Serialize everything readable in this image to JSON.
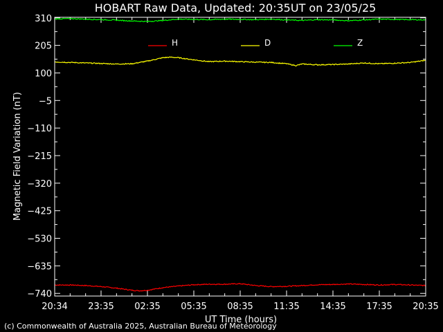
{
  "colors": {
    "background": "#000000",
    "axes": "#ffffff",
    "H": "#ff0000",
    "D": "#ffff00",
    "Z": "#00ff00"
  },
  "chart_data": {
    "type": "line",
    "title": "HOBART Raw Data, Updated: 20:35UT on 23/05/25",
    "xlabel": "UT Time (hours)",
    "ylabel": "Magnetic Field Variation (nT)",
    "footer": "(c) Commonwealth of Australia 2025, Australian Bureau of Meteorology",
    "xlim": [
      0,
      24
    ],
    "ylim": [
      -750,
      312
    ],
    "x_tick_labels": [
      "20:34",
      "23:35",
      "02:35",
      "05:35",
      "08:35",
      "11:35",
      "14:35",
      "17:35",
      "20:35"
    ],
    "y_ticks": [
      310,
      205,
      100,
      -5,
      -110,
      -215,
      -320,
      -425,
      -530,
      -635,
      -740
    ],
    "y_tick_labels": [
      "310",
      "205",
      "100",
      "−5",
      "−110",
      "−215",
      "−320",
      "−425",
      "−530",
      "−635",
      "−740"
    ],
    "legend_position": "top",
    "series": [
      {
        "name": "H",
        "color": "#ff0000",
        "x": [
          0,
          1,
          2,
          3,
          4,
          5,
          5.5,
          6,
          7,
          8,
          9,
          10,
          11,
          12,
          13,
          14,
          15,
          16,
          17,
          18,
          19,
          20,
          21,
          22,
          23,
          24
        ],
        "y": [
          -708,
          -708,
          -710,
          -714,
          -720,
          -728,
          -730,
          -728,
          -718,
          -712,
          -707,
          -705,
          -705,
          -703,
          -710,
          -714,
          -713,
          -710,
          -707,
          -706,
          -704,
          -706,
          -708,
          -706,
          -708,
          -710
        ]
      },
      {
        "name": "D",
        "color": "#ffff00",
        "x": [
          0,
          1,
          2,
          3,
          4,
          5,
          6,
          7,
          7.5,
          8,
          9,
          10,
          11,
          12,
          13,
          14,
          15,
          15.6,
          16,
          17,
          18,
          19,
          20,
          21,
          22,
          23,
          24
        ],
        "y": [
          142,
          140,
          138,
          136,
          134,
          135,
          145,
          158,
          160,
          158,
          150,
          143,
          145,
          143,
          141,
          140,
          135,
          128,
          134,
          131,
          132,
          134,
          138,
          135,
          137,
          140,
          148
        ]
      },
      {
        "name": "Z",
        "color": "#00ff00",
        "x": [
          0,
          1,
          2,
          3,
          4,
          5,
          6,
          7,
          8,
          9,
          10,
          11,
          12,
          13,
          14,
          15,
          16,
          17,
          18,
          19,
          20,
          21,
          22,
          23,
          24
        ],
        "y": [
          306,
          307,
          305,
          303,
          301,
          298,
          296,
          300,
          305,
          304,
          303,
          305,
          304,
          303,
          305,
          302,
          300,
          303,
          302,
          299,
          302,
          305,
          304,
          303,
          302
        ]
      }
    ]
  }
}
